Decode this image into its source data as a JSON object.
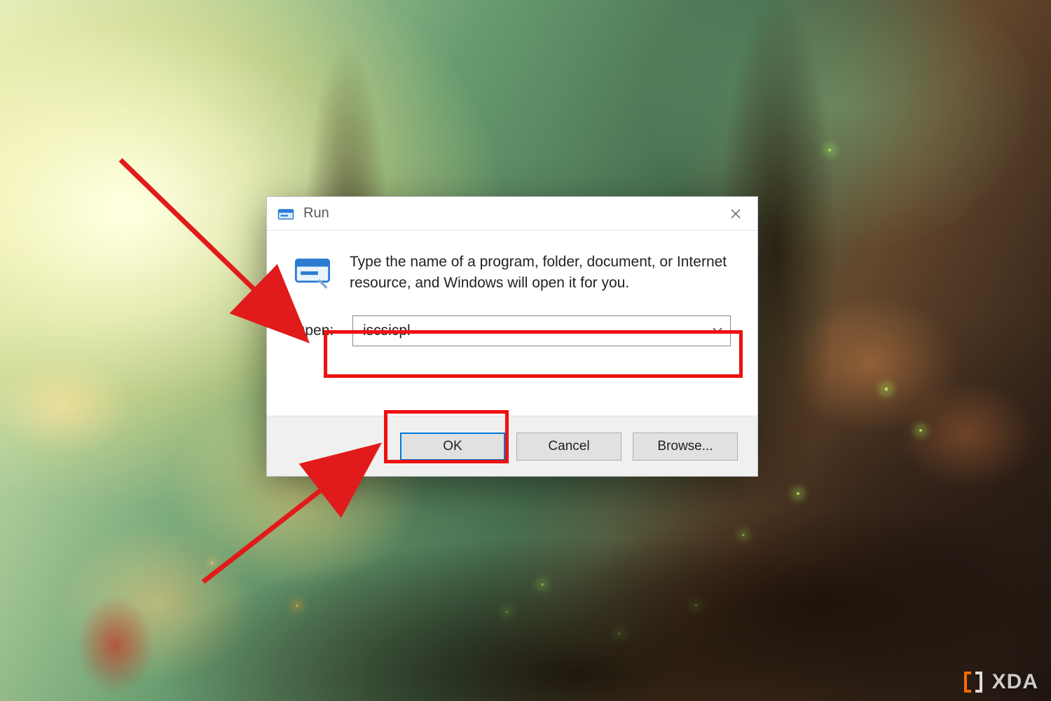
{
  "dialog": {
    "title": "Run",
    "description": "Type the name of a program, folder, document, or Internet resource, and Windows will open it for you.",
    "open_label": "Open:",
    "input_value": "iscsicpl",
    "buttons": {
      "ok": "OK",
      "cancel": "Cancel",
      "browse": "Browse..."
    }
  },
  "watermark": {
    "text": "XDA"
  },
  "colors": {
    "highlight": "#e11b1b",
    "accent": "#0078d7"
  }
}
